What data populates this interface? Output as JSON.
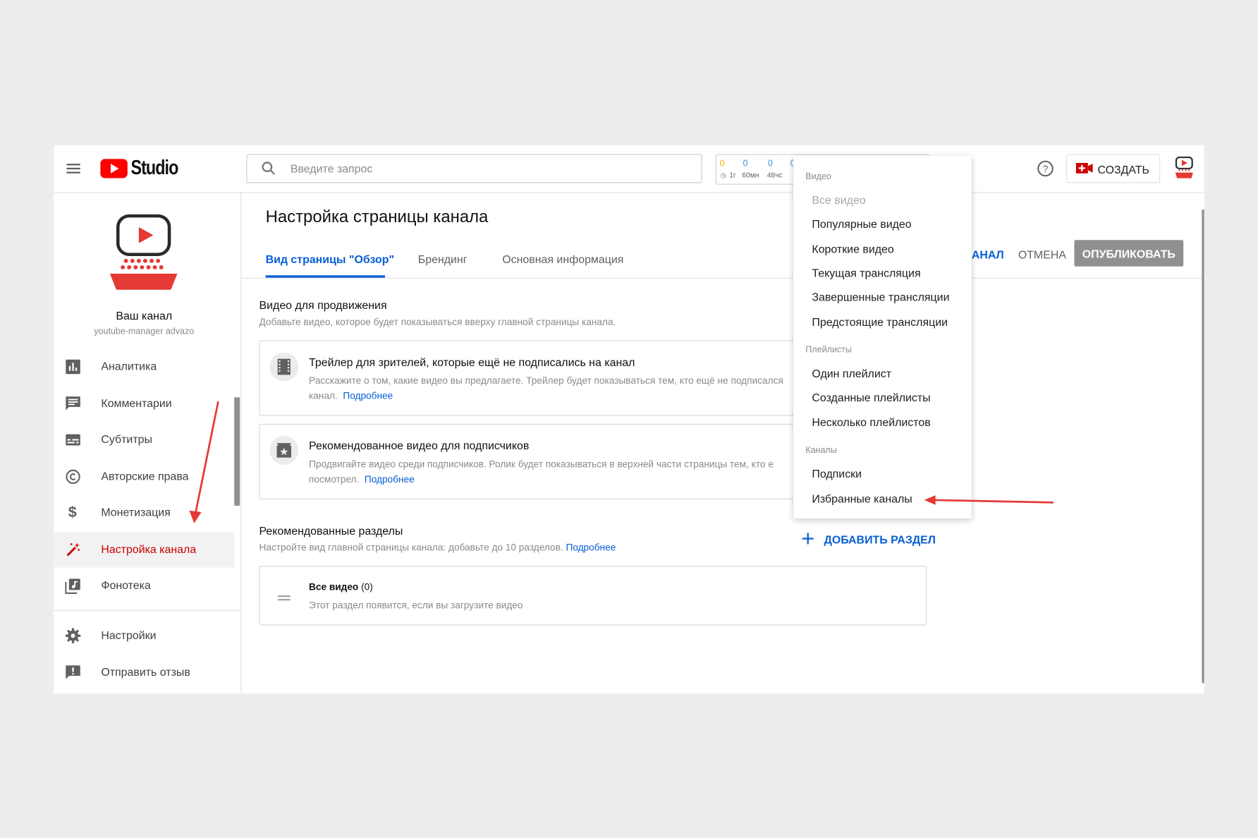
{
  "header": {
    "logo_text": "Studio",
    "search_placeholder": "Введите запрос",
    "stats": [
      {
        "value": "0",
        "label": "1г",
        "color": "#f2b600"
      },
      {
        "value": "0",
        "label": "60мн",
        "color": "#4a90d9"
      },
      {
        "value": "0",
        "label": "48чс",
        "color": "#4a90d9"
      },
      {
        "value": "0",
        "label": "",
        "color": "#4a90d9"
      }
    ],
    "create_label": "СОЗДАТЬ"
  },
  "sidebar": {
    "channel_name": "Ваш канал",
    "channel_handle": "youtube-manager advazo",
    "items": [
      {
        "label": "Аналитика",
        "icon": "analytics-icon"
      },
      {
        "label": "Комментарии",
        "icon": "comments-icon"
      },
      {
        "label": "Субтитры",
        "icon": "subtitles-icon"
      },
      {
        "label": "Авторские права",
        "icon": "copyright-icon"
      },
      {
        "label": "Монетизация",
        "icon": "dollar-icon"
      },
      {
        "label": "Настройка канала",
        "icon": "magic-wand-icon",
        "active": true
      },
      {
        "label": "Фонотека",
        "icon": "audio-library-icon"
      }
    ],
    "bottom_items": [
      {
        "label": "Настройки",
        "icon": "gear-icon"
      },
      {
        "label": "Отправить отзыв",
        "icon": "feedback-icon"
      }
    ]
  },
  "main": {
    "page_title": "Настройка страницы канала",
    "tabs": [
      {
        "label": "Вид страницы \"Обзор\"",
        "active": true
      },
      {
        "label": "Брендинг"
      },
      {
        "label": "Основная информация"
      }
    ],
    "actions": {
      "view_channel_partial": "АНАЛ",
      "cancel": "ОТМЕНА",
      "publish": "ОПУБЛИКОВАТЬ"
    },
    "promo_section": {
      "title": "Видео для продвижения",
      "description": "Добавьте видео, которое будет показываться вверху главной страницы канала."
    },
    "cards": [
      {
        "title": "Трейлер для зрителей, которые ещё не подписались на канал",
        "line1": "Расскажите о том, какие видео вы предлагаете. Трейлер будет показываться тем, кто ещё не подписался",
        "line2": "канал.",
        "link": "Подробнее"
      },
      {
        "title": "Рекомендованное видео для подписчиков",
        "line1": "Продвигайте видео среди подписчиков. Ролик будет показываться в верхней части страницы тем, кто е",
        "line2": "посмотрел.",
        "link": "Подробнее"
      }
    ],
    "featured_sections": {
      "title": "Рекомендованные разделы",
      "description": "Настройте вид главной страницы канала: добавьте до 10 разделов.",
      "link": "Подробнее",
      "add_button": "ДОБАВИТЬ РАЗДЕЛ",
      "section_item": {
        "title": "Все видео",
        "count": "(0)",
        "description": "Этот раздел появится, если вы загрузите видео"
      }
    }
  },
  "dropdown": {
    "groups": [
      {
        "heading": "Видео",
        "items": [
          {
            "label": "Все видео",
            "disabled": true
          },
          {
            "label": "Популярные видео"
          },
          {
            "label": "Короткие видео"
          },
          {
            "label": "Текущая трансляция"
          },
          {
            "label": "Завершенные трансляции"
          },
          {
            "label": "Предстоящие трансляции"
          }
        ]
      },
      {
        "heading": "Плейлисты",
        "items": [
          {
            "label": "Один плейлист"
          },
          {
            "label": "Созданные плейлисты"
          },
          {
            "label": "Несколько плейлистов"
          }
        ]
      },
      {
        "heading": "Каналы",
        "items": [
          {
            "label": "Подписки"
          },
          {
            "label": "Избранные каналы"
          }
        ]
      }
    ]
  },
  "colors": {
    "brand_red": "#ff0000",
    "active_red": "#cc0000",
    "link_blue": "#065fd4",
    "annotation_arrow": "#e53935"
  }
}
